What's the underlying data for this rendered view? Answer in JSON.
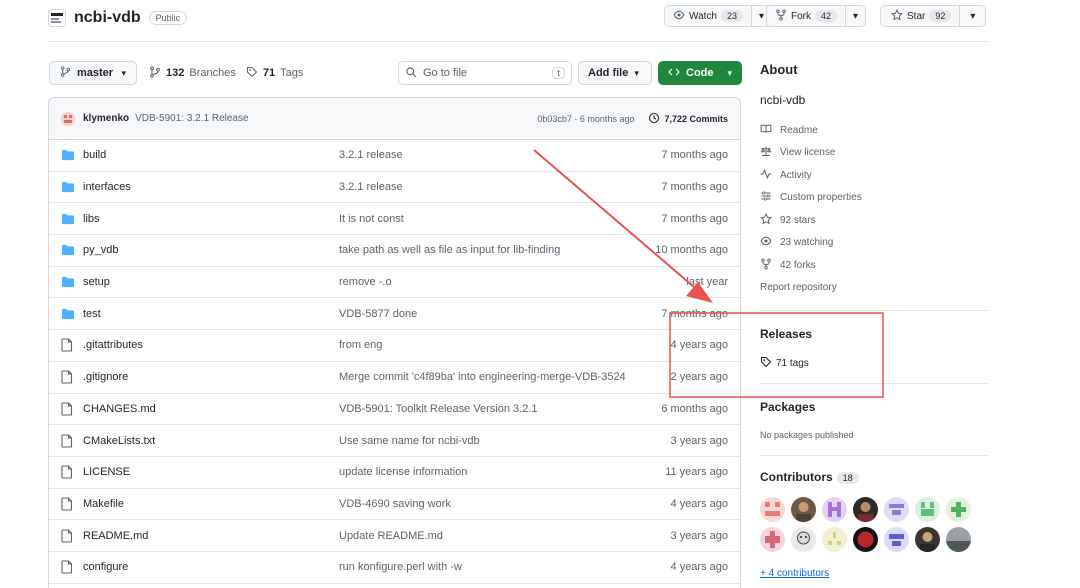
{
  "repo": {
    "name": "ncbi-vdb",
    "visibility": "Public"
  },
  "actions": {
    "watch": {
      "label": "Watch",
      "count": "23"
    },
    "fork": {
      "label": "Fork",
      "count": "42"
    },
    "star": {
      "label": "Star",
      "count": "92"
    }
  },
  "toolbar": {
    "branch": "master",
    "branches_count": "132",
    "branches_label": "Branches",
    "tags_count": "71",
    "tags_label": "Tags",
    "search_placeholder": "Go to file",
    "search_shortcut": "t",
    "add_file": "Add file",
    "code": "Code"
  },
  "latest_commit": {
    "author": "klymenko",
    "message": "VDB-5901: 3.2.1 Release",
    "hash_time": "0b03cb7 · 6 months ago",
    "commits": "7,722 Commits"
  },
  "files": [
    {
      "type": "dir",
      "name": "build",
      "message": "3.2.1 release",
      "date": "7 months ago"
    },
    {
      "type": "dir",
      "name": "interfaces",
      "message": "3.2.1 release",
      "date": "7 months ago"
    },
    {
      "type": "dir",
      "name": "libs",
      "message": "It is not const",
      "date": "7 months ago"
    },
    {
      "type": "dir",
      "name": "py_vdb",
      "message": "take path as well as file as input for lib-finding",
      "date": "10 months ago"
    },
    {
      "type": "dir",
      "name": "setup",
      "message": "remove -.o",
      "date": "last year"
    },
    {
      "type": "dir",
      "name": "test",
      "message": "VDB-5877 done",
      "date": "7 months ago"
    },
    {
      "type": "file",
      "name": ".gitattributes",
      "message": "from eng",
      "date": "4 years ago"
    },
    {
      "type": "file",
      "name": ".gitignore",
      "message": "Merge commit 'c4f89ba' into engineering-merge-VDB-3524",
      "date": "2 years ago"
    },
    {
      "type": "file",
      "name": "CHANGES.md",
      "message": "VDB-5901: Toolkit Release Version 3.2.1",
      "date": "6 months ago"
    },
    {
      "type": "file",
      "name": "CMakeLists.txt",
      "message": "Use same name for ncbi-vdb",
      "date": "3 years ago"
    },
    {
      "type": "file",
      "name": "LICENSE",
      "message": "update license information",
      "date": "11 years ago"
    },
    {
      "type": "file",
      "name": "Makefile",
      "message": "VDB-4690 saving work",
      "date": "4 years ago"
    },
    {
      "type": "file",
      "name": "README.md",
      "message": "Update README.md",
      "date": "3 years ago"
    },
    {
      "type": "file",
      "name": "configure",
      "message": "run konfigure.perl with -w",
      "date": "4 years ago"
    }
  ],
  "about": {
    "heading": "About",
    "description": "ncbi-vdb",
    "links": [
      {
        "icon": "book-icon",
        "label": "Readme"
      },
      {
        "icon": "scale-icon",
        "label": "View license"
      },
      {
        "icon": "pulse-icon",
        "label": "Activity"
      },
      {
        "icon": "properties-icon",
        "label": "Custom properties"
      },
      {
        "icon": "star-icon",
        "label": "92 stars"
      },
      {
        "icon": "eye-icon",
        "label": "23 watching"
      },
      {
        "icon": "fork-icon",
        "label": "42 forks"
      }
    ],
    "report": "Report repository"
  },
  "releases": {
    "heading": "Releases",
    "tags": "71 tags"
  },
  "packages": {
    "heading": "Packages",
    "empty": "No packages published"
  },
  "contributors": {
    "heading": "Contributors",
    "count": "18",
    "more": "+ 4 contributors"
  },
  "colors": {
    "accent_green": "#1f883d",
    "link_blue": "#0969da",
    "annotation_red": "#e8524f",
    "folder_blue": "#54aeff"
  }
}
